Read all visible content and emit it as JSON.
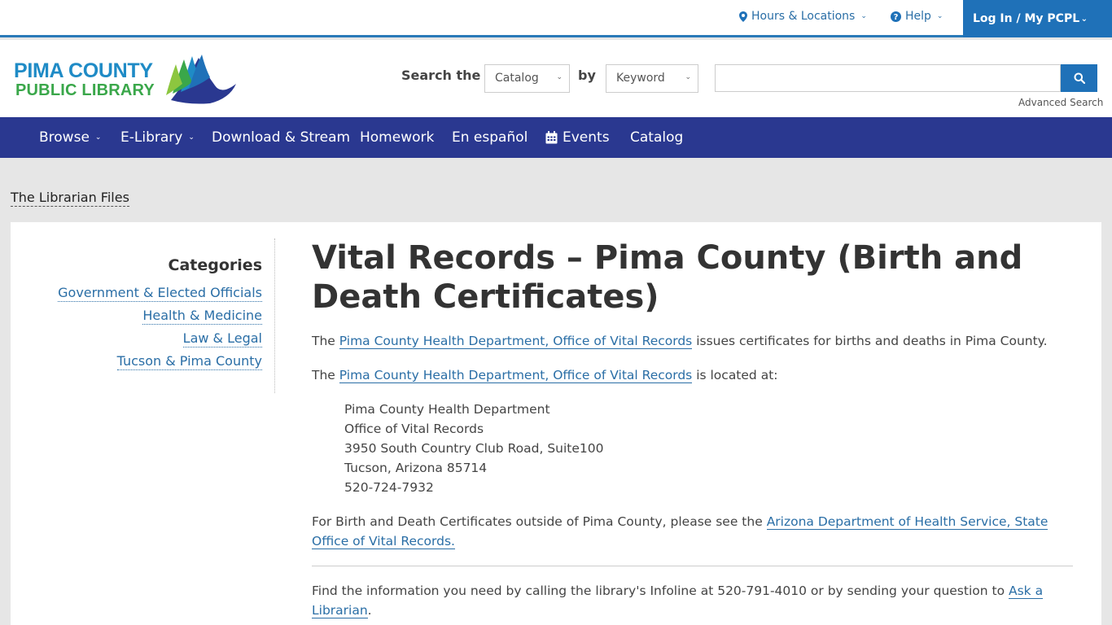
{
  "utility": {
    "hours_label": "Hours & Locations",
    "help_label": "Help",
    "login_label": "Log In / My PCPL"
  },
  "logo": {
    "line1": "PIMA COUNTY",
    "line2": "PUBLIC LIBRARY"
  },
  "search": {
    "label": "Search the",
    "scope": "Catalog",
    "by_label": "by",
    "type": "Keyword",
    "query": "",
    "advanced_label": "Advanced Search"
  },
  "nav": {
    "items": [
      "Browse",
      "E-Library",
      "Download & Stream",
      "Homework",
      "En español",
      "Events",
      "Catalog"
    ]
  },
  "breadcrumb": "The Librarian Files",
  "sidebar": {
    "title": "Categories",
    "links": [
      "Government & Elected Officials",
      "Health & Medicine",
      "Law & Legal",
      "Tucson & Pima County"
    ]
  },
  "article": {
    "title": "Vital Records – Pima County (Birth and Death Certificates)",
    "p1_pre": "The ",
    "p1_link": "Pima County Health Department, Office of Vital Records",
    "p1_post": " issues certificates for births and deaths in Pima County.",
    "p2_pre": "The ",
    "p2_link": "Pima County Health Department, Office of Vital Records",
    "p2_post": " is located at:",
    "address": [
      "Pima County Health Department",
      "Office of Vital Records",
      "3950 South Country Club Road, Suite100",
      "Tucson, Arizona 85714",
      "520-724-7932"
    ],
    "p3_pre": "For Birth and Death Certificates outside of Pima County, please see the ",
    "p3_link": "Arizona Department of Health Service, State Office of Vital Records.",
    "p4_pre": "Find the information you need by calling the library's Infoline at 520-791-4010 or by sending your question to ",
    "p4_link": "Ask a Librarian",
    "p4_post": "."
  },
  "colors": {
    "brand_blue": "#1f71b8",
    "nav_blue": "#2a3890",
    "link_blue": "#2a6ea6"
  }
}
